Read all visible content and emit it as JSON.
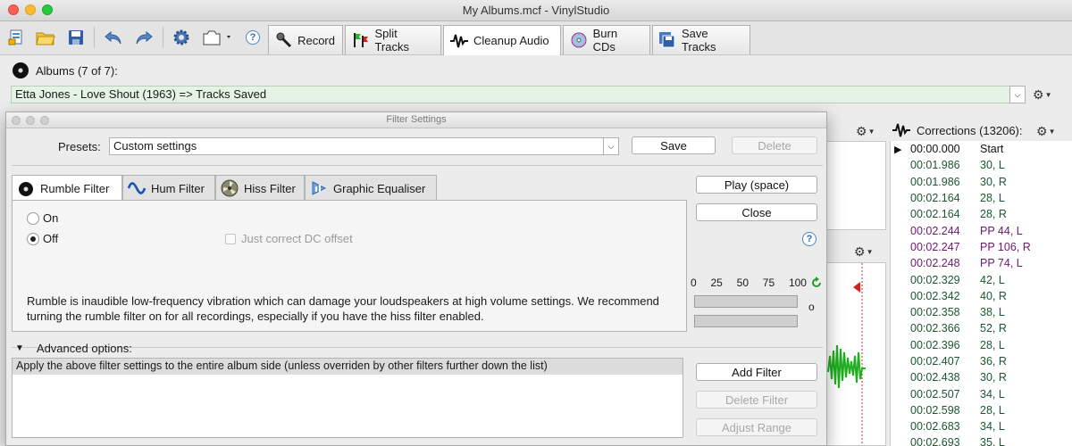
{
  "window": {
    "title": "My Albums.mcf - VinylStudio"
  },
  "toolbar": {
    "icons": [
      "new-document-icon",
      "open-folder-icon",
      "save-disk-icon",
      "undo-icon",
      "redo-icon",
      "settings-gear-icon",
      "window-menu-icon",
      "help-icon"
    ],
    "help_label": "?",
    "tabs": [
      {
        "label": "Record",
        "icon": "microphone-icon"
      },
      {
        "label": "Split Tracks",
        "icon": "flags-icon"
      },
      {
        "label": "Cleanup Audio",
        "icon": "waveform-icon"
      },
      {
        "label": "Burn CDs",
        "icon": "cd-icon"
      },
      {
        "label": "Save Tracks",
        "icon": "save-tracks-icon"
      }
    ],
    "active_tab": "Cleanup Audio"
  },
  "albums": {
    "label": "Albums (7 of 7):",
    "selected": "Etta Jones - Love Shout (1963) => Tracks Saved"
  },
  "corrections": {
    "header": "Corrections (13206):",
    "rows": [
      {
        "time": "00:00.000",
        "value": "Start",
        "kind": "start",
        "current": true
      },
      {
        "time": "00:01.986",
        "value": "30, L",
        "kind": "click"
      },
      {
        "time": "00:01.986",
        "value": "30, R",
        "kind": "click"
      },
      {
        "time": "00:02.164",
        "value": "28, L",
        "kind": "click"
      },
      {
        "time": "00:02.164",
        "value": "28, R",
        "kind": "click"
      },
      {
        "time": "00:02.244",
        "value": "PP 44, L",
        "kind": "pp"
      },
      {
        "time": "00:02.247",
        "value": "PP 106, R",
        "kind": "pp"
      },
      {
        "time": "00:02.248",
        "value": "PP 74, L",
        "kind": "pp"
      },
      {
        "time": "00:02.329",
        "value": "42, L",
        "kind": "click"
      },
      {
        "time": "00:02.342",
        "value": "40, R",
        "kind": "click"
      },
      {
        "time": "00:02.358",
        "value": "38, L",
        "kind": "click"
      },
      {
        "time": "00:02.366",
        "value": "52, R",
        "kind": "click"
      },
      {
        "time": "00:02.396",
        "value": "28, L",
        "kind": "click"
      },
      {
        "time": "00:02.407",
        "value": "36, R",
        "kind": "click"
      },
      {
        "time": "00:02.438",
        "value": "30, R",
        "kind": "click"
      },
      {
        "time": "00:02.507",
        "value": "34, L",
        "kind": "click"
      },
      {
        "time": "00:02.598",
        "value": "28, L",
        "kind": "click"
      },
      {
        "time": "00:02.683",
        "value": "34, L",
        "kind": "click"
      },
      {
        "time": "00:02.693",
        "value": "35, L",
        "kind": "click"
      }
    ]
  },
  "dialog": {
    "title": "Filter Settings",
    "presets_label": "Presets:",
    "presets_value": "Custom settings",
    "save_label": "Save",
    "delete_label": "Delete",
    "play_label": "Play (space)",
    "close_label": "Close",
    "help_label": "?",
    "subtabs": [
      {
        "label": "Rumble Filter",
        "icon": "vinyl-record-icon"
      },
      {
        "label": "Hum Filter",
        "icon": "sine-wave-icon"
      },
      {
        "label": "Hiss Filter",
        "icon": "fan-icon"
      },
      {
        "label": "Graphic Equaliser",
        "icon": "equaliser-icon"
      }
    ],
    "active_subtab": "Rumble Filter",
    "rumble": {
      "on_label": "On",
      "off_label": "Off",
      "selected": "Off",
      "dc_offset_label": "Just correct DC offset",
      "dc_offset_checked": false,
      "description": "Rumble is inaudible low-frequency vibration which can damage your loudspeakers at high volume settings.  We recommend turning the rumble filter on for all recordings, especially if you have the hiss filter enabled."
    },
    "meter": {
      "scale": [
        "0",
        "25",
        "50",
        "75",
        "100"
      ],
      "mode_symbol": "o",
      "left_level": 0,
      "right_level": 0
    },
    "advanced_label": "Advanced options:",
    "filter_list": [
      "Apply the above filter settings to the entire album side (unless overriden by other filters further down the list)"
    ],
    "add_filter_label": "Add Filter",
    "delete_filter_label": "Delete Filter",
    "adjust_range_label": "Adjust Range"
  },
  "colors": {
    "album_bg": "#e4f3e4",
    "pp_text": "#6b1a6b",
    "click_text": "#1c5530",
    "waveform": "#1fae1f",
    "marker": "#d62020"
  }
}
